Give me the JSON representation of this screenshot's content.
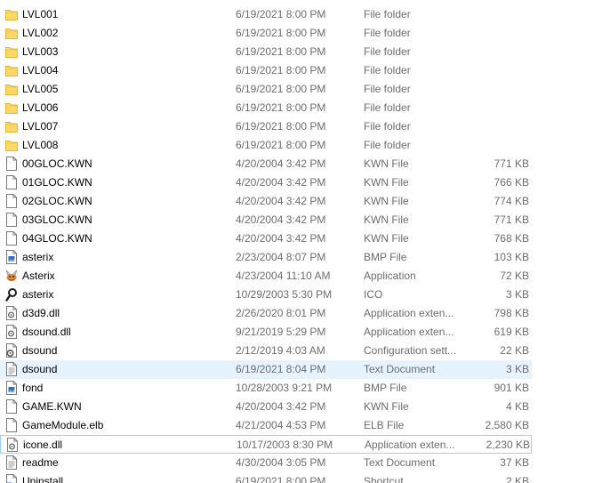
{
  "files": [
    {
      "name": "LVL001",
      "date": "6/19/2021 8:00 PM",
      "type": "File folder",
      "size": "",
      "icon": "folder-icon"
    },
    {
      "name": "LVL002",
      "date": "6/19/2021 8:00 PM",
      "type": "File folder",
      "size": "",
      "icon": "folder-icon"
    },
    {
      "name": "LVL003",
      "date": "6/19/2021 8:00 PM",
      "type": "File folder",
      "size": "",
      "icon": "folder-icon"
    },
    {
      "name": "LVL004",
      "date": "6/19/2021 8:00 PM",
      "type": "File folder",
      "size": "",
      "icon": "folder-icon"
    },
    {
      "name": "LVL005",
      "date": "6/19/2021 8:00 PM",
      "type": "File folder",
      "size": "",
      "icon": "folder-icon"
    },
    {
      "name": "LVL006",
      "date": "6/19/2021 8:00 PM",
      "type": "File folder",
      "size": "",
      "icon": "folder-icon"
    },
    {
      "name": "LVL007",
      "date": "6/19/2021 8:00 PM",
      "type": "File folder",
      "size": "",
      "icon": "folder-icon"
    },
    {
      "name": "LVL008",
      "date": "6/19/2021 8:00 PM",
      "type": "File folder",
      "size": "",
      "icon": "folder-icon"
    },
    {
      "name": "00GLOC.KWN",
      "date": "4/20/2004 3:42 PM",
      "type": "KWN File",
      "size": "771 KB",
      "icon": "blank-file-icon"
    },
    {
      "name": "01GLOC.KWN",
      "date": "4/20/2004 3:42 PM",
      "type": "KWN File",
      "size": "766 KB",
      "icon": "blank-file-icon"
    },
    {
      "name": "02GLOC.KWN",
      "date": "4/20/2004 3:42 PM",
      "type": "KWN File",
      "size": "774 KB",
      "icon": "blank-file-icon"
    },
    {
      "name": "03GLOC.KWN",
      "date": "4/20/2004 3:42 PM",
      "type": "KWN File",
      "size": "771 KB",
      "icon": "blank-file-icon"
    },
    {
      "name": "04GLOC.KWN",
      "date": "4/20/2004 3:42 PM",
      "type": "KWN File",
      "size": "768 KB",
      "icon": "blank-file-icon"
    },
    {
      "name": "asterix",
      "date": "2/23/2004 8:07 PM",
      "type": "BMP File",
      "size": "103 KB",
      "icon": "bitmap-file-icon"
    },
    {
      "name": "Asterix",
      "date": "4/23/2004 11:10 AM",
      "type": "Application",
      "size": "72 KB",
      "icon": "asterix-app-icon"
    },
    {
      "name": "asterix",
      "date": "10/29/2003 5:30 PM",
      "type": "ICO",
      "size": "3 KB",
      "icon": "magnifier-icon"
    },
    {
      "name": "d3d9.dll",
      "date": "2/26/2020 8:01 PM",
      "type": "Application exten...",
      "size": "798 KB",
      "icon": "dll-gear-file-icon"
    },
    {
      "name": "dsound.dll",
      "date": "9/21/2019 5:29 PM",
      "type": "Application exten...",
      "size": "619 KB",
      "icon": "dll-gear-file-icon"
    },
    {
      "name": "dsound",
      "date": "2/12/2019 4:03 AM",
      "type": "Configuration sett...",
      "size": "22 KB",
      "icon": "config-gear-file-icon"
    },
    {
      "name": "dsound",
      "date": "6/19/2021 8:04 PM",
      "type": "Text Document",
      "size": "3 KB",
      "icon": "text-file-icon"
    },
    {
      "name": "fond",
      "date": "10/28/2003 9:21 PM",
      "type": "BMP File",
      "size": "901 KB",
      "icon": "bitmap-file-icon"
    },
    {
      "name": "GAME.KWN",
      "date": "4/20/2004 3:42 PM",
      "type": "KWN File",
      "size": "4 KB",
      "icon": "blank-file-icon"
    },
    {
      "name": "GameModule.elb",
      "date": "4/21/2004 4:53 PM",
      "type": "ELB File",
      "size": "2,580 KB",
      "icon": "blank-file-icon"
    },
    {
      "name": "icone.dll",
      "date": "10/17/2003 8:30 PM",
      "type": "Application exten...",
      "size": "2,230 KB",
      "icon": "dll-gear-file-icon"
    },
    {
      "name": "readme",
      "date": "4/30/2004 3:05 PM",
      "type": "Text Document",
      "size": "37 KB",
      "icon": "text-file-icon"
    },
    {
      "name": "Uninstall",
      "date": "6/19/2021 8:00 PM",
      "type": "Shortcut",
      "size": "2 KB",
      "icon": "shortcut-file-icon"
    }
  ],
  "selected_row": 19,
  "focused_row": 23,
  "colors": {
    "folder": "#ffd866",
    "selection": "#e5f3ff",
    "focus_border": "#99d1ff",
    "secondary_text": "#6d6d6d"
  }
}
